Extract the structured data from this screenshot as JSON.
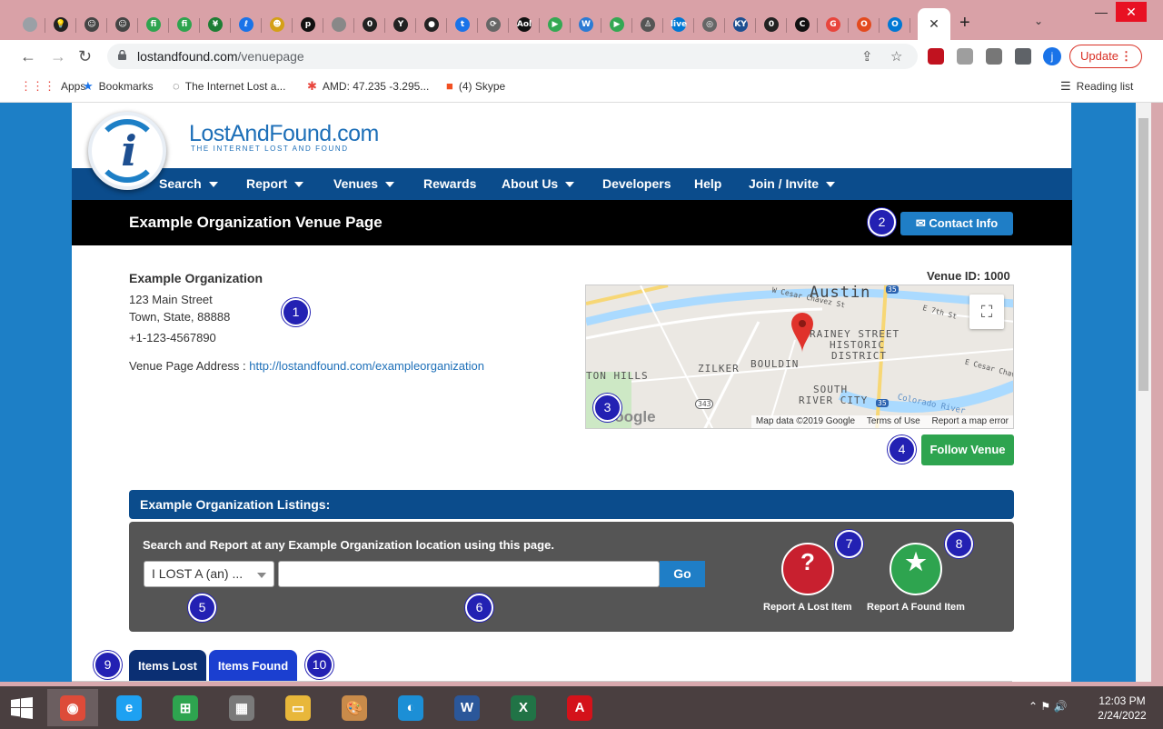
{
  "browser": {
    "tab_favicons": [
      {
        "icon": "blank-globe-icon",
        "color": "#9aa0a6",
        "glyph": ""
      },
      {
        "icon": "lightbulb-icon",
        "color": "#222222",
        "glyph": "💡"
      },
      {
        "icon": "smiley-icon",
        "color": "#444444",
        "glyph": "☺"
      },
      {
        "icon": "smiley-icon",
        "color": "#444444",
        "glyph": "☺"
      },
      {
        "icon": "fi-green-icon",
        "color": "#2ea44f",
        "glyph": "fi"
      },
      {
        "icon": "fi-green-icon",
        "color": "#2ea44f",
        "glyph": "fi"
      },
      {
        "icon": "yen-green-icon",
        "color": "#1e7e34",
        "glyph": "¥"
      },
      {
        "icon": "blue-circle-icon",
        "color": "#1a73e8",
        "glyph": "ℓ"
      },
      {
        "icon": "cartoon-face-icon",
        "color": "#d4a017",
        "glyph": "☻"
      },
      {
        "icon": "p-black-icon",
        "color": "#111111",
        "glyph": "p"
      },
      {
        "icon": "grey-circle-icon",
        "color": "#888888",
        "glyph": ""
      },
      {
        "icon": "zero-icon",
        "color": "#222222",
        "glyph": "0"
      },
      {
        "icon": "y-black-icon",
        "color": "#222222",
        "glyph": "Y"
      },
      {
        "icon": "record-icon",
        "color": "#222222",
        "glyph": "●"
      },
      {
        "icon": "t-blue-icon",
        "color": "#1a73e8",
        "glyph": "t"
      },
      {
        "icon": "refresh-globe-icon",
        "color": "#666666",
        "glyph": "⟳"
      },
      {
        "icon": "aol-icon",
        "color": "#111111",
        "glyph": "Aol"
      },
      {
        "icon": "play-store-icon",
        "color": "#34a853",
        "glyph": "▶"
      },
      {
        "icon": "w-box-icon",
        "color": "#2b7bd4",
        "glyph": "W"
      },
      {
        "icon": "play-store-icon",
        "color": "#34a853",
        "glyph": "▶"
      },
      {
        "icon": "person-icon",
        "color": "#555555",
        "glyph": "♙"
      },
      {
        "icon": "live-icon",
        "color": "#0078d4",
        "glyph": "live"
      },
      {
        "icon": "chrome-gray-icon",
        "color": "#666666",
        "glyph": "◎"
      },
      {
        "icon": "kyue-icon",
        "color": "#1d4f91",
        "glyph": "KY"
      },
      {
        "icon": "zero-icon",
        "color": "#222222",
        "glyph": "0"
      },
      {
        "icon": "c-black-icon",
        "color": "#111111",
        "glyph": "C"
      },
      {
        "icon": "g-red-icon",
        "color": "#e8453c",
        "glyph": "G"
      },
      {
        "icon": "office-icon",
        "color": "#e34a1e",
        "glyph": "O"
      },
      {
        "icon": "outlook-icon",
        "color": "#0078d4",
        "glyph": "O"
      }
    ],
    "active_tab_close": "✕",
    "new_tab": "+",
    "tab_search": "⌄",
    "window_controls": {
      "minimize": "—",
      "maximize": "❐",
      "close": "✕"
    },
    "url_host": "lostandfound.com",
    "url_path": "/venuepage",
    "profile_initial": "j",
    "update_label": "Update",
    "bookmarks": [
      {
        "label": "Apps",
        "icon": "apps-grid-icon"
      },
      {
        "label": "Bookmarks",
        "icon": "star-icon"
      },
      {
        "label": "The Internet Lost a...",
        "icon": "lostandfound-icon"
      },
      {
        "label": "AMD: 47.235 -3.295...",
        "icon": "nbc-peacock-icon"
      },
      {
        "label": "(4) Skype",
        "icon": "windows-logo-icon"
      }
    ],
    "reading_list": "Reading list"
  },
  "site": {
    "brand_name": "LostAndFound.com",
    "brand_tagline": "THE INTERNET LOST AND FOUND",
    "logo_letter": "i",
    "nav": [
      {
        "label": "Search",
        "dropdown": true
      },
      {
        "label": "Report",
        "dropdown": true
      },
      {
        "label": "Venues",
        "dropdown": true
      },
      {
        "label": "Rewards",
        "dropdown": false
      },
      {
        "label": "About Us",
        "dropdown": true
      },
      {
        "label": "Developers",
        "dropdown": false
      },
      {
        "label": "Help",
        "dropdown": false
      },
      {
        "label": "Join / Invite",
        "dropdown": true
      }
    ],
    "page_title": "Example Organization Venue Page",
    "contact_button": "✉ Contact Info",
    "organization": {
      "name": "Example Organization",
      "street": "123 Main Street",
      "city_line": "Town, State, 88888",
      "phone": "+1-123-4567890",
      "venue_address_label": "Venue Page Address :",
      "venue_address_url": "http://lostandfound.com/exampleorganization"
    },
    "venue_id": "Venue ID: 1000",
    "map": {
      "city": "Austin",
      "labels": [
        "W Cesar Chavez St",
        "E 7th St",
        "RAINEY STREET",
        "HISTORIC",
        "DISTRICT",
        "ZILKER",
        "BOULDIN",
        "TON HILLS",
        "SOUTH",
        "RIVER CITY",
        "E Cesar Chavez",
        "Colorado River",
        "343",
        "35",
        "35"
      ],
      "footer_data": "Map data ©2019 Google",
      "footer_terms": "Terms of Use",
      "footer_report": "Report a map error",
      "google_mark": "Google"
    },
    "follow_button": "Follow Venue",
    "listings_title": "Example Organization Listings:",
    "search_caption": "Search and Report at any Example Organization location using this page.",
    "lost_select_value": "I LOST A (an) ...",
    "search_placeholder": "",
    "go_button": "Go",
    "report_lost": "Report A Lost Item",
    "report_found": "Report A Found Item",
    "tab_lost": "Items Lost",
    "tab_found": "Items Found"
  },
  "markers": [
    "1",
    "2",
    "3",
    "4",
    "5",
    "6",
    "7",
    "8",
    "9",
    "10"
  ],
  "taskbar": {
    "apps": [
      {
        "name": "chrome",
        "icon": "chrome-icon",
        "color": "#dd4b39",
        "glyph": "◉",
        "active": true
      },
      {
        "name": "internet-explorer",
        "icon": "ie-icon",
        "color": "#1ea1f2",
        "glyph": "e",
        "active": false
      },
      {
        "name": "store",
        "icon": "store-icon",
        "color": "#2ea44f",
        "glyph": "⊞",
        "active": false
      },
      {
        "name": "calculator",
        "icon": "calculator-icon",
        "color": "#7a7a7a",
        "glyph": "▦",
        "active": false
      },
      {
        "name": "file-explorer",
        "icon": "folder-icon",
        "color": "#e8b73a",
        "glyph": "▭",
        "active": false
      },
      {
        "name": "paint",
        "icon": "palette-icon",
        "color": "#c98b4a",
        "glyph": "🎨",
        "active": false
      },
      {
        "name": "edge",
        "icon": "edge-icon",
        "color": "#1c8fd6",
        "glyph": "◐",
        "active": false
      },
      {
        "name": "word",
        "icon": "word-icon",
        "color": "#2b579a",
        "glyph": "W",
        "active": false
      },
      {
        "name": "excel",
        "icon": "excel-icon",
        "color": "#217346",
        "glyph": "X",
        "active": false
      },
      {
        "name": "acrobat",
        "icon": "acrobat-icon",
        "color": "#d4121a",
        "glyph": "A",
        "active": false
      }
    ],
    "time": "12:03 PM",
    "date": "2/24/2022"
  },
  "colors": {
    "brand_blue": "#0b4c8c",
    "accent_blue": "#1f7ec6",
    "follow_green": "#2ea44f",
    "lost_red": "#c8202f",
    "marker_blue": "#2321b3"
  }
}
